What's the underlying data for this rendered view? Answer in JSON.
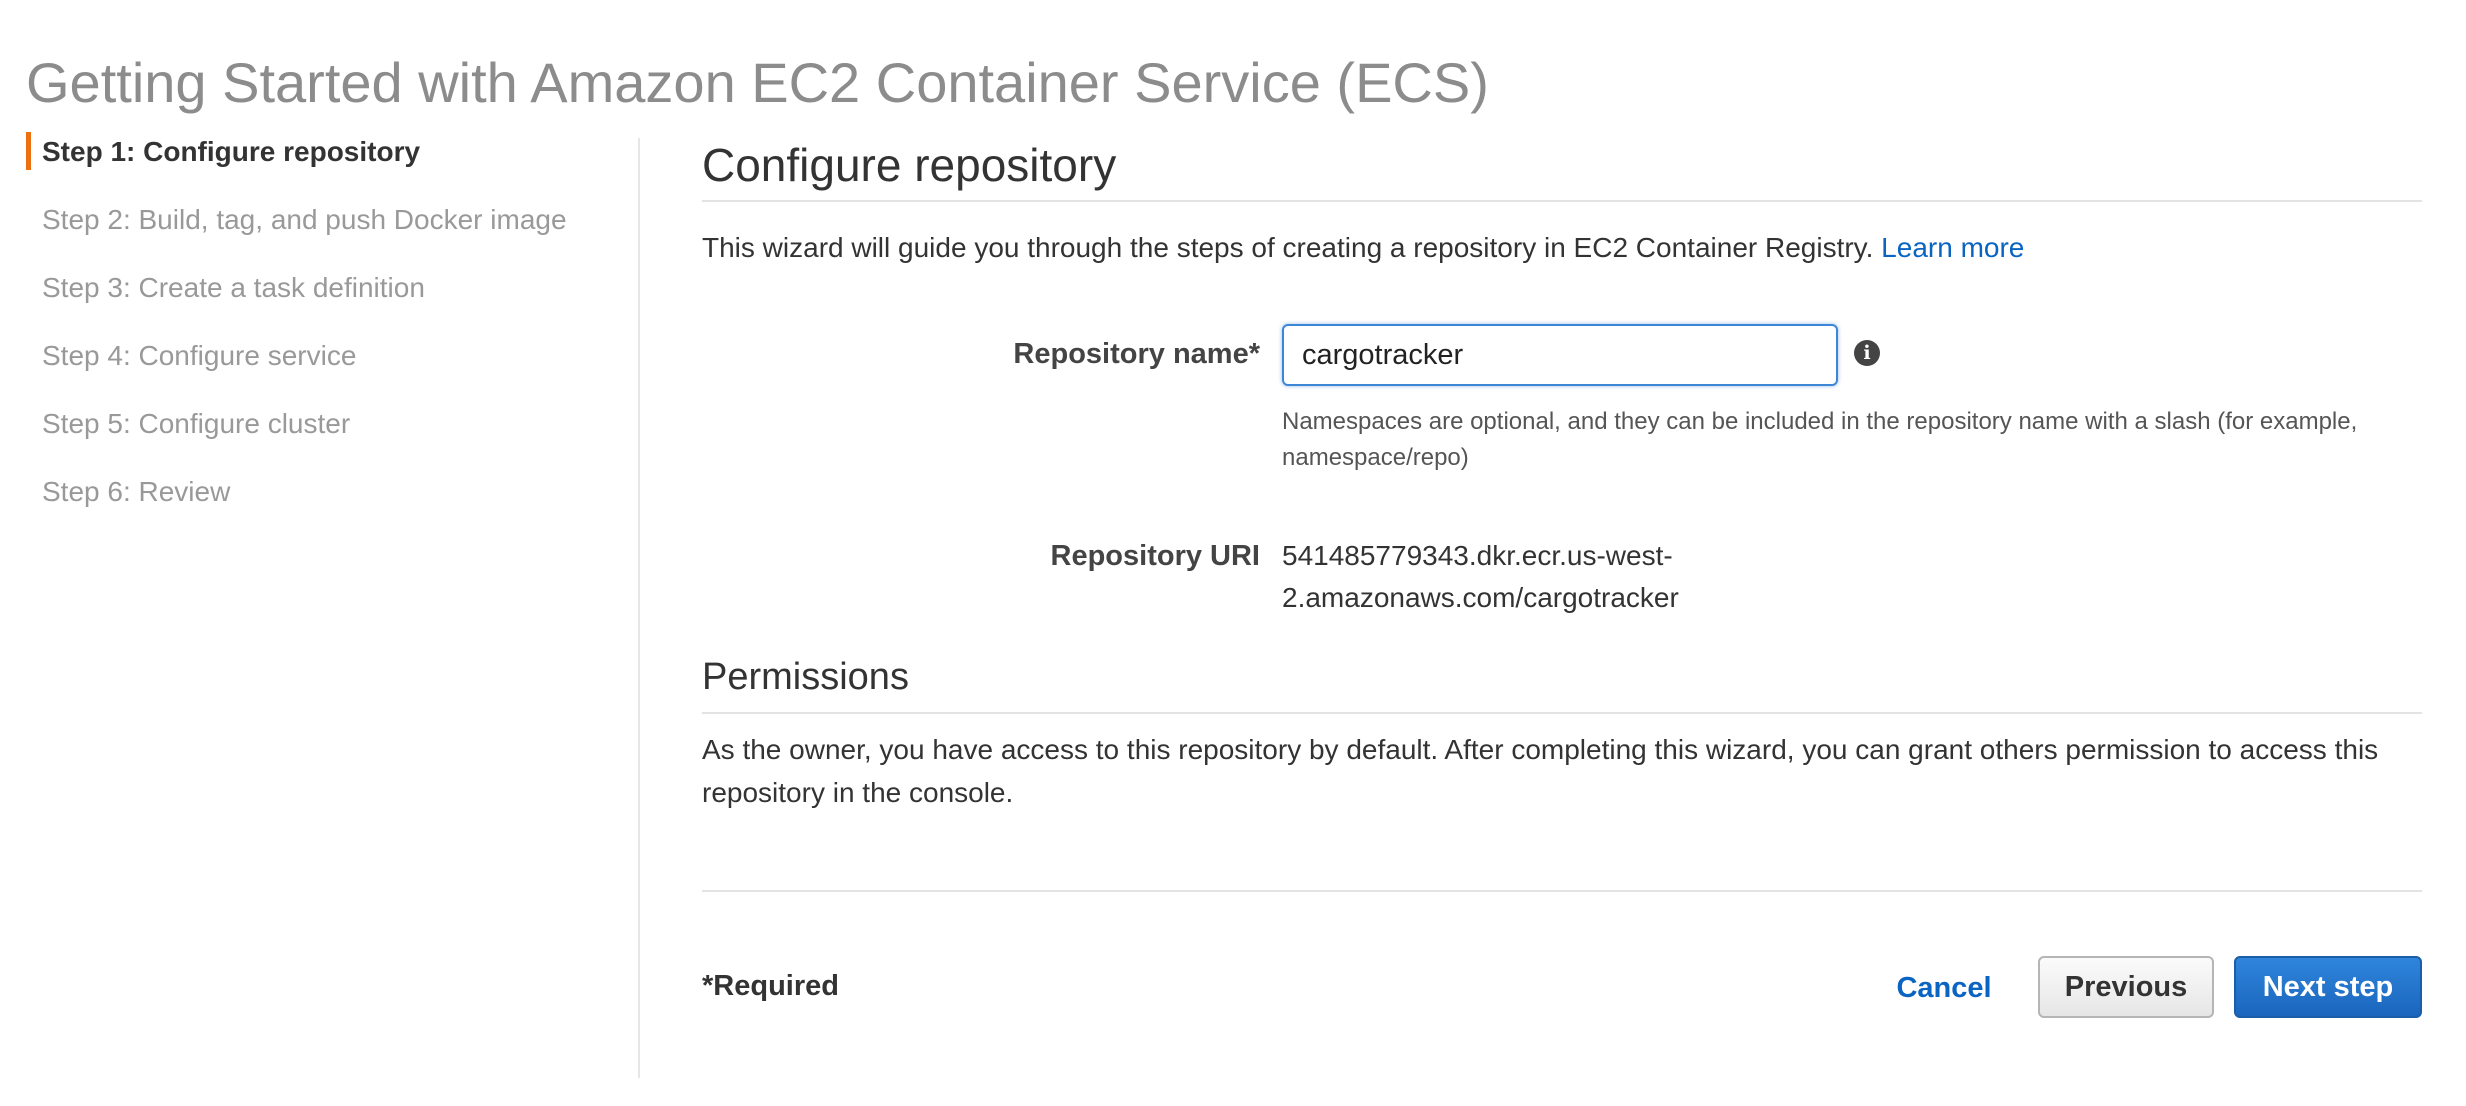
{
  "page": {
    "title": "Getting Started with Amazon EC2 Container Service (ECS)"
  },
  "sidebar": {
    "steps": [
      {
        "label": "Step 1: Configure repository",
        "active": true
      },
      {
        "label": "Step 2: Build, tag, and push Docker image",
        "active": false
      },
      {
        "label": "Step 3: Create a task definition",
        "active": false
      },
      {
        "label": "Step 4: Configure service",
        "active": false
      },
      {
        "label": "Step 5: Configure cluster",
        "active": false
      },
      {
        "label": "Step 6: Review",
        "active": false
      }
    ]
  },
  "main": {
    "heading": "Configure repository",
    "intro_text": "This wizard will guide you through the steps of creating a repository in EC2 Container Registry.",
    "learn_more": "Learn more",
    "repository_name": {
      "label": "Repository name*",
      "value": "cargotracker",
      "helper": "Namespaces are optional, and they can be included in the repository name with a slash (for example, namespace/repo)"
    },
    "repository_uri": {
      "label": "Repository URI",
      "value": "541485779343.dkr.ecr.us-west-2.amazonaws.com/cargotracker"
    },
    "permissions": {
      "heading": "Permissions",
      "text": "As the owner, you have access to this repository by default. After completing this wizard, you can grant others permission to access this repository in the console."
    }
  },
  "footer": {
    "required_note": "*Required",
    "cancel_label": "Cancel",
    "previous_label": "Previous",
    "next_label": "Next step"
  },
  "colors": {
    "accent": "#ec7211",
    "link": "#0a64c2",
    "primary_button": "#1a65bd",
    "muted_text": "#999999"
  },
  "icons": {
    "info": "info-icon"
  }
}
